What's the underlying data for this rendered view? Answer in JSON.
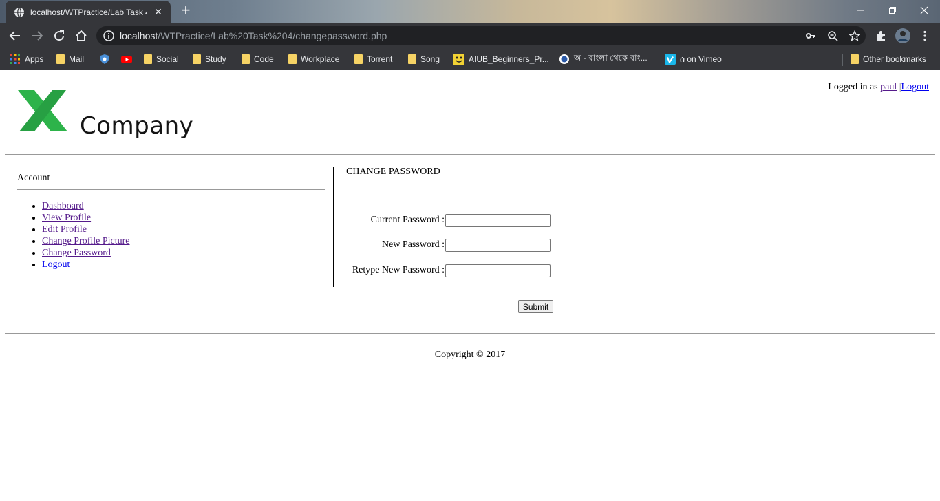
{
  "browser": {
    "tab_title": "localhost/WTPractice/Lab Task 4",
    "url_host": "localhost",
    "url_path": "/WTPractice/Lab%20Task%204/changepassword.php",
    "bookmarks": [
      {
        "label": "Apps",
        "icon": "apps-grid-icon"
      },
      {
        "label": "Mail",
        "icon": "folder-icon"
      },
      {
        "label": "",
        "icon": "shield-favicon-icon"
      },
      {
        "label": "",
        "icon": "youtube-icon"
      },
      {
        "label": "Social",
        "icon": "folder-icon"
      },
      {
        "label": "Study",
        "icon": "folder-icon"
      },
      {
        "label": "Code",
        "icon": "folder-icon"
      },
      {
        "label": "Workplace",
        "icon": "folder-icon"
      },
      {
        "label": "Torrent",
        "icon": "folder-icon"
      },
      {
        "label": "Song",
        "icon": "folder-icon"
      },
      {
        "label": "AIUB_Beginners_Pr...",
        "icon": "smiley-favicon-icon"
      },
      {
        "label": "অ - বাংলা থেকে বাং...",
        "icon": "circle-favicon-icon"
      },
      {
        "label": "ሰ on Vimeo",
        "icon": "vimeo-icon"
      }
    ],
    "other_bookmarks": "Other bookmarks"
  },
  "header": {
    "logo_text": "Company",
    "logged_in_prefix": "Logged in as",
    "username": "paul",
    "separator": "|",
    "logout_label": "Logout"
  },
  "sidebar": {
    "title": "Account",
    "items": [
      {
        "label": "Dashboard"
      },
      {
        "label": "View Profile"
      },
      {
        "label": "Edit Profile"
      },
      {
        "label": "Change Profile Picture"
      },
      {
        "label": "Change Password"
      },
      {
        "label": "Logout"
      }
    ]
  },
  "main": {
    "title": "CHANGE PASSWORD",
    "fields": [
      {
        "label": "Current Password :",
        "value": ""
      },
      {
        "label": "New Password :",
        "value": ""
      },
      {
        "label": "Retype New Password :",
        "value": ""
      }
    ],
    "submit_label": "Submit"
  },
  "footer": {
    "copyright": "Copyright © 2017"
  },
  "colors": {
    "link": "#0000ee",
    "visited_link": "#551a8b",
    "logo_green": "#2db34a",
    "chrome_dark": "#35363a"
  }
}
